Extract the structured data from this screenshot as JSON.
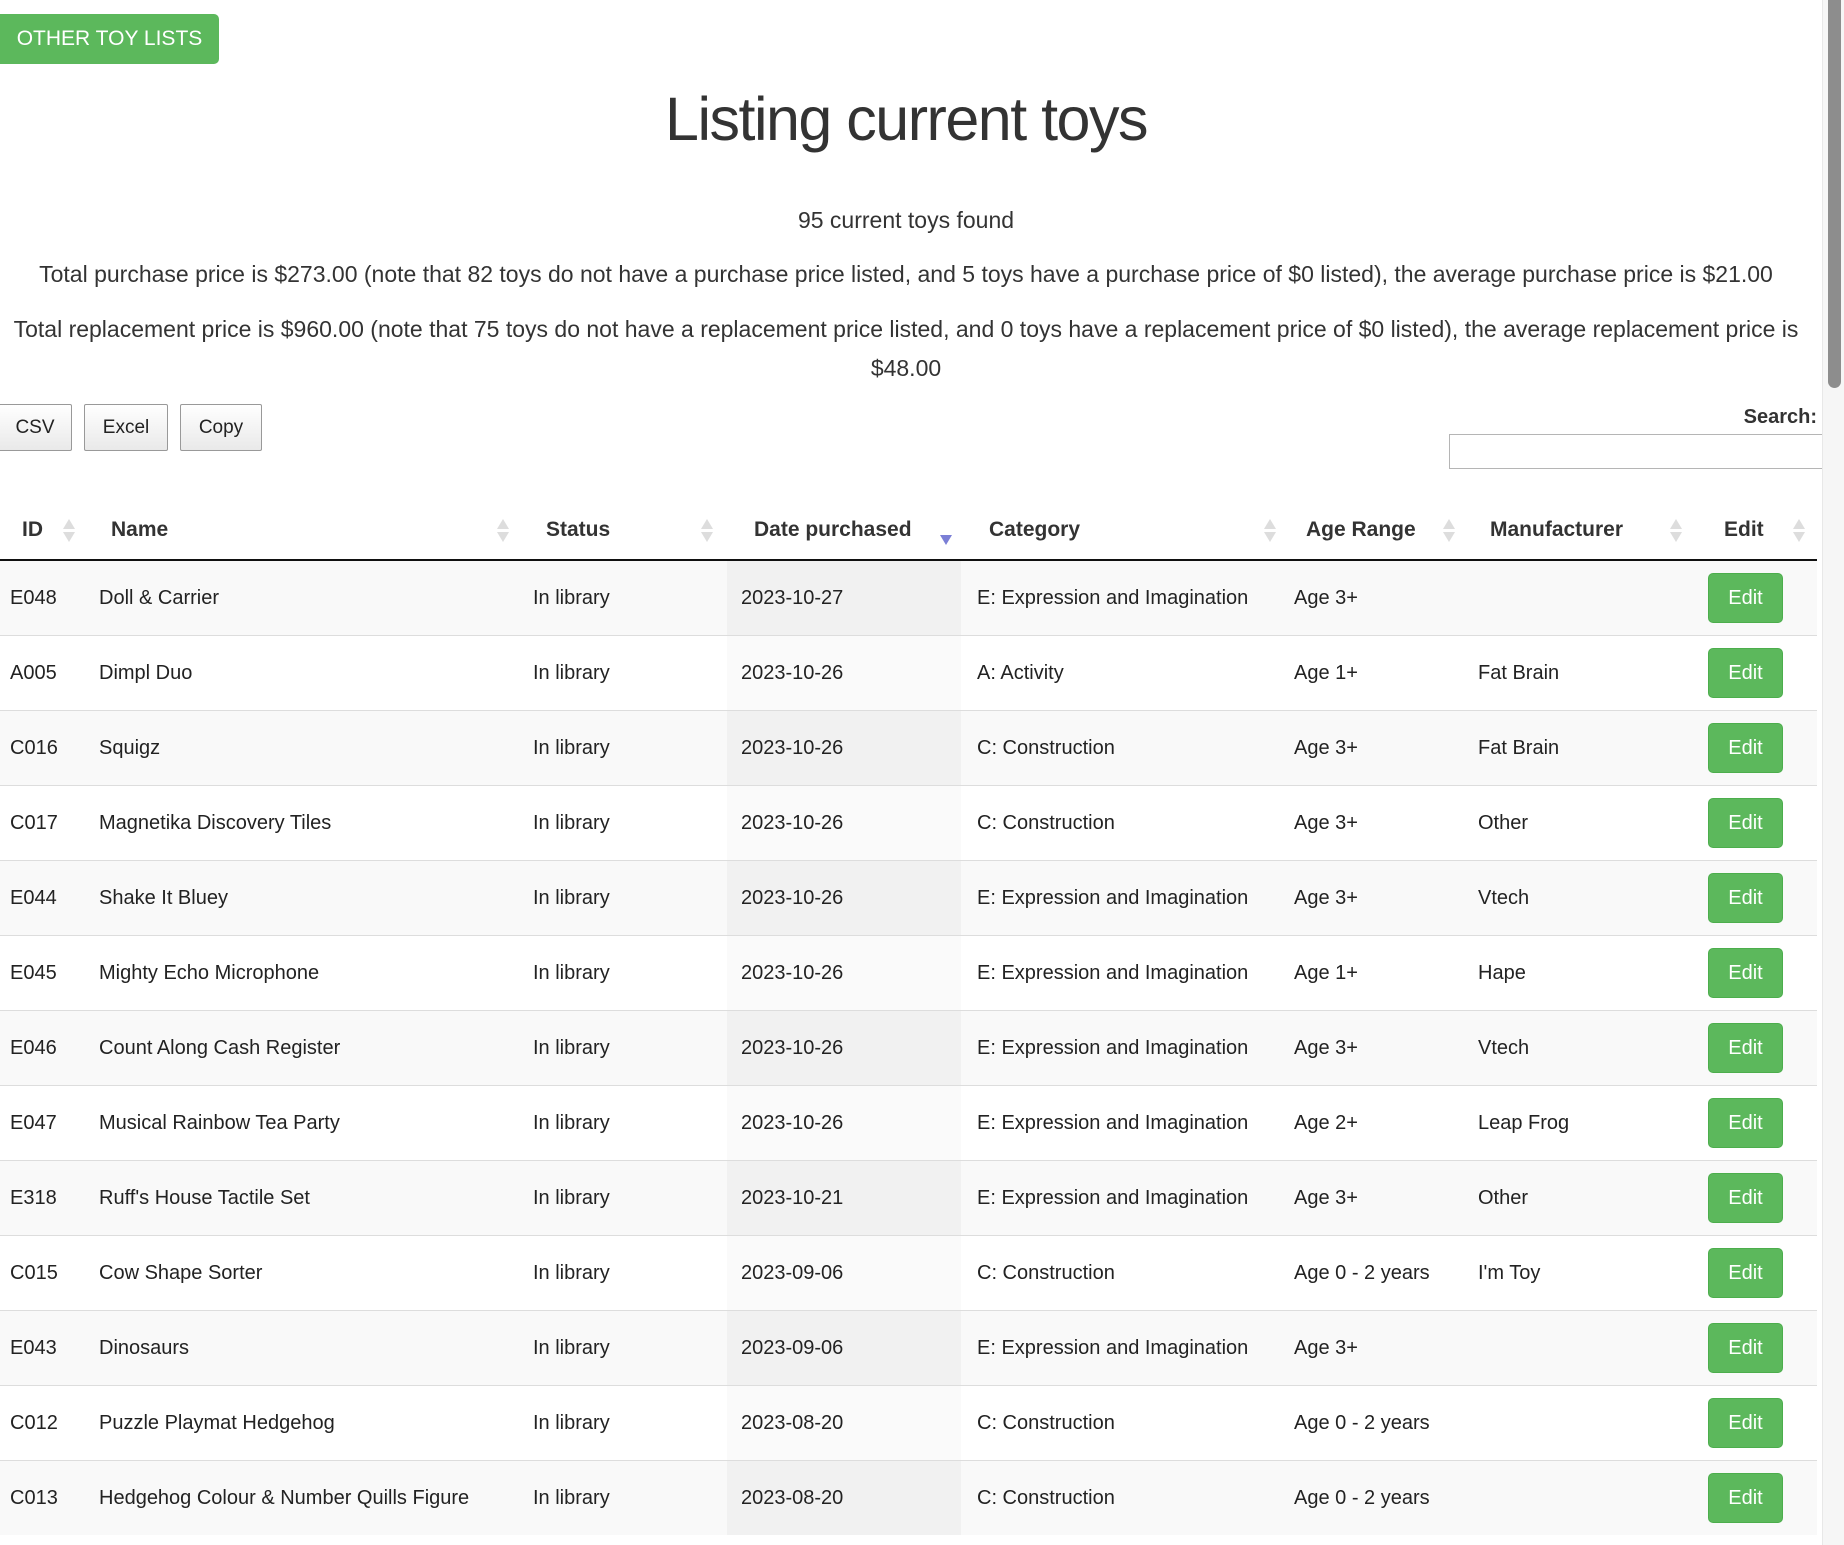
{
  "nav": {
    "other_lists_label": "OTHER TOY LISTS"
  },
  "header": {
    "title": "Listing current toys"
  },
  "summary": {
    "count_text": "95 current toys found",
    "purchase_text": "Total purchase price is $273.00 (note that 82 toys do not have a purchase price listed, and 5 toys have a purchase price of $0 listed), the average purchase price is $21.00",
    "replacement_text": "Total replacement price is $960.00 (note that 75 toys do not have a replacement price listed, and 0 toys have a replacement price of $0 listed), the average replacement price is $48.00"
  },
  "toolbar": {
    "csv_label": "CSV",
    "excel_label": "Excel",
    "copy_label": "Copy",
    "search_label": "Search:",
    "search_value": ""
  },
  "table": {
    "sorted_column": "Date purchased",
    "sort_direction": "descending",
    "columns": [
      "ID",
      "Name",
      "Status",
      "Date purchased",
      "Category",
      "Age Range",
      "Manufacturer",
      "Edit"
    ],
    "rows": [
      {
        "id": "E048",
        "name": "Doll & Carrier",
        "status": "In library",
        "date": "2023-10-27",
        "category": "E: Expression and Imagination",
        "age": "Age 3+",
        "manufacturer": "",
        "edit": "Edit"
      },
      {
        "id": "A005",
        "name": "Dimpl Duo",
        "status": "In library",
        "date": "2023-10-26",
        "category": "A: Activity",
        "age": "Age 1+",
        "manufacturer": "Fat Brain",
        "edit": "Edit"
      },
      {
        "id": "C016",
        "name": "Squigz",
        "status": "In library",
        "date": "2023-10-26",
        "category": "C: Construction",
        "age": "Age 3+",
        "manufacturer": "Fat Brain",
        "edit": "Edit"
      },
      {
        "id": "C017",
        "name": "Magnetika Discovery Tiles",
        "status": "In library",
        "date": "2023-10-26",
        "category": "C: Construction",
        "age": "Age 3+",
        "manufacturer": "Other",
        "edit": "Edit"
      },
      {
        "id": "E044",
        "name": "Shake It Bluey",
        "status": "In library",
        "date": "2023-10-26",
        "category": "E: Expression and Imagination",
        "age": "Age 3+",
        "manufacturer": "Vtech",
        "edit": "Edit"
      },
      {
        "id": "E045",
        "name": "Mighty Echo Microphone",
        "status": "In library",
        "date": "2023-10-26",
        "category": "E: Expression and Imagination",
        "age": "Age 1+",
        "manufacturer": "Hape",
        "edit": "Edit"
      },
      {
        "id": "E046",
        "name": "Count Along Cash Register",
        "status": "In library",
        "date": "2023-10-26",
        "category": "E: Expression and Imagination",
        "age": "Age 3+",
        "manufacturer": "Vtech",
        "edit": "Edit"
      },
      {
        "id": "E047",
        "name": "Musical Rainbow Tea Party",
        "status": "In library",
        "date": "2023-10-26",
        "category": "E: Expression and Imagination",
        "age": "Age 2+",
        "manufacturer": "Leap Frog",
        "edit": "Edit"
      },
      {
        "id": "E318",
        "name": "Ruff's House Tactile Set",
        "status": "In library",
        "date": "2023-10-21",
        "category": "E: Expression and Imagination",
        "age": "Age 3+",
        "manufacturer": "Other",
        "edit": "Edit"
      },
      {
        "id": "C015",
        "name": "Cow Shape Sorter",
        "status": "In library",
        "date": "2023-09-06",
        "category": "C: Construction",
        "age": "Age 0 - 2 years",
        "manufacturer": "I'm Toy",
        "edit": "Edit"
      },
      {
        "id": "E043",
        "name": "Dinosaurs",
        "status": "In library",
        "date": "2023-09-06",
        "category": "E: Expression and Imagination",
        "age": "Age 3+",
        "manufacturer": "",
        "edit": "Edit"
      },
      {
        "id": "C012",
        "name": "Puzzle Playmat Hedgehog",
        "status": "In library",
        "date": "2023-08-20",
        "category": "C: Construction",
        "age": "Age 0 - 2 years",
        "manufacturer": "",
        "edit": "Edit"
      },
      {
        "id": "C013",
        "name": "Hedgehog Colour & Number Quills Figure",
        "status": "In library",
        "date": "2023-08-20",
        "category": "C: Construction",
        "age": "Age 0 - 2 years",
        "manufacturer": "",
        "edit": "Edit"
      }
    ]
  },
  "colors": {
    "accent_green": "#5cb85c",
    "sort_active": "#7b7fd6",
    "text": "#333333"
  }
}
